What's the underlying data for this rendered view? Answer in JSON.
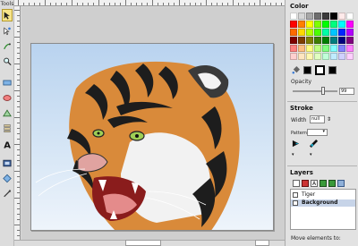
{
  "toolbar": {
    "title": "Tools",
    "tools": [
      {
        "name": "select-tool",
        "icon": "arrow-pointer-icon",
        "active": true
      },
      {
        "name": "node-tool",
        "icon": "node-edit-icon"
      },
      {
        "name": "tweak-tool",
        "icon": "tweak-icon"
      },
      {
        "name": "zoom-tool",
        "icon": "magnify-icon"
      },
      {
        "name": "rect-tool",
        "icon": "rectangle-icon"
      },
      {
        "name": "ellipse-tool",
        "icon": "ellipse-icon"
      },
      {
        "name": "path-tool",
        "icon": "path-icon"
      },
      {
        "name": "text-tool",
        "icon": "text-A-icon",
        "label": "A"
      },
      {
        "name": "image-tool",
        "icon": "image-icon"
      },
      {
        "name": "gradient-tool",
        "icon": "gradient-icon"
      },
      {
        "name": "eyedropper-tool",
        "icon": "eyedropper-icon"
      }
    ]
  },
  "panel": {
    "color_title": "Color",
    "palette": [
      "#ffffff",
      "#d6d6d6",
      "#a8a8a8",
      "#6e6e6e",
      "#3a3a3a",
      "#000000",
      "#ffeaea",
      "#ffffff",
      "#ff0000",
      "#ff7f00",
      "#ffff00",
      "#7fff00",
      "#00ff00",
      "#00ff7f",
      "#00ffff",
      "#ff00ff",
      "#ff6a00",
      "#ffd800",
      "#b6ff00",
      "#4cff00",
      "#00ffa5",
      "#00c6ff",
      "#0026ff",
      "#b200ff",
      "#7f0000",
      "#7f3f00",
      "#7f7f00",
      "#3f7f00",
      "#007f00",
      "#007f7f",
      "#00007f",
      "#7f007f",
      "#ff8080",
      "#ffbf80",
      "#ffff80",
      "#bfff80",
      "#80ff80",
      "#80ffff",
      "#8080ff",
      "#ff80ff",
      "#ffd0d0",
      "#ffe6c0",
      "#fff8b0",
      "#e0ffc0",
      "#c0ffd8",
      "#c0ecff",
      "#d0d0ff",
      "#ffd0ff"
    ],
    "opacity_label": "Opacity",
    "opacity_value": "99",
    "stroke_title": "Stroke",
    "width_label": "Width",
    "width_value": "null",
    "pattern_label": "Pattern",
    "layers_title": "Layers",
    "layers": [
      {
        "name": "Tiger",
        "selected": false
      },
      {
        "name": "Background",
        "selected": true
      }
    ],
    "move_label": "Move elements to:"
  },
  "status": {
    "zoom": ""
  }
}
